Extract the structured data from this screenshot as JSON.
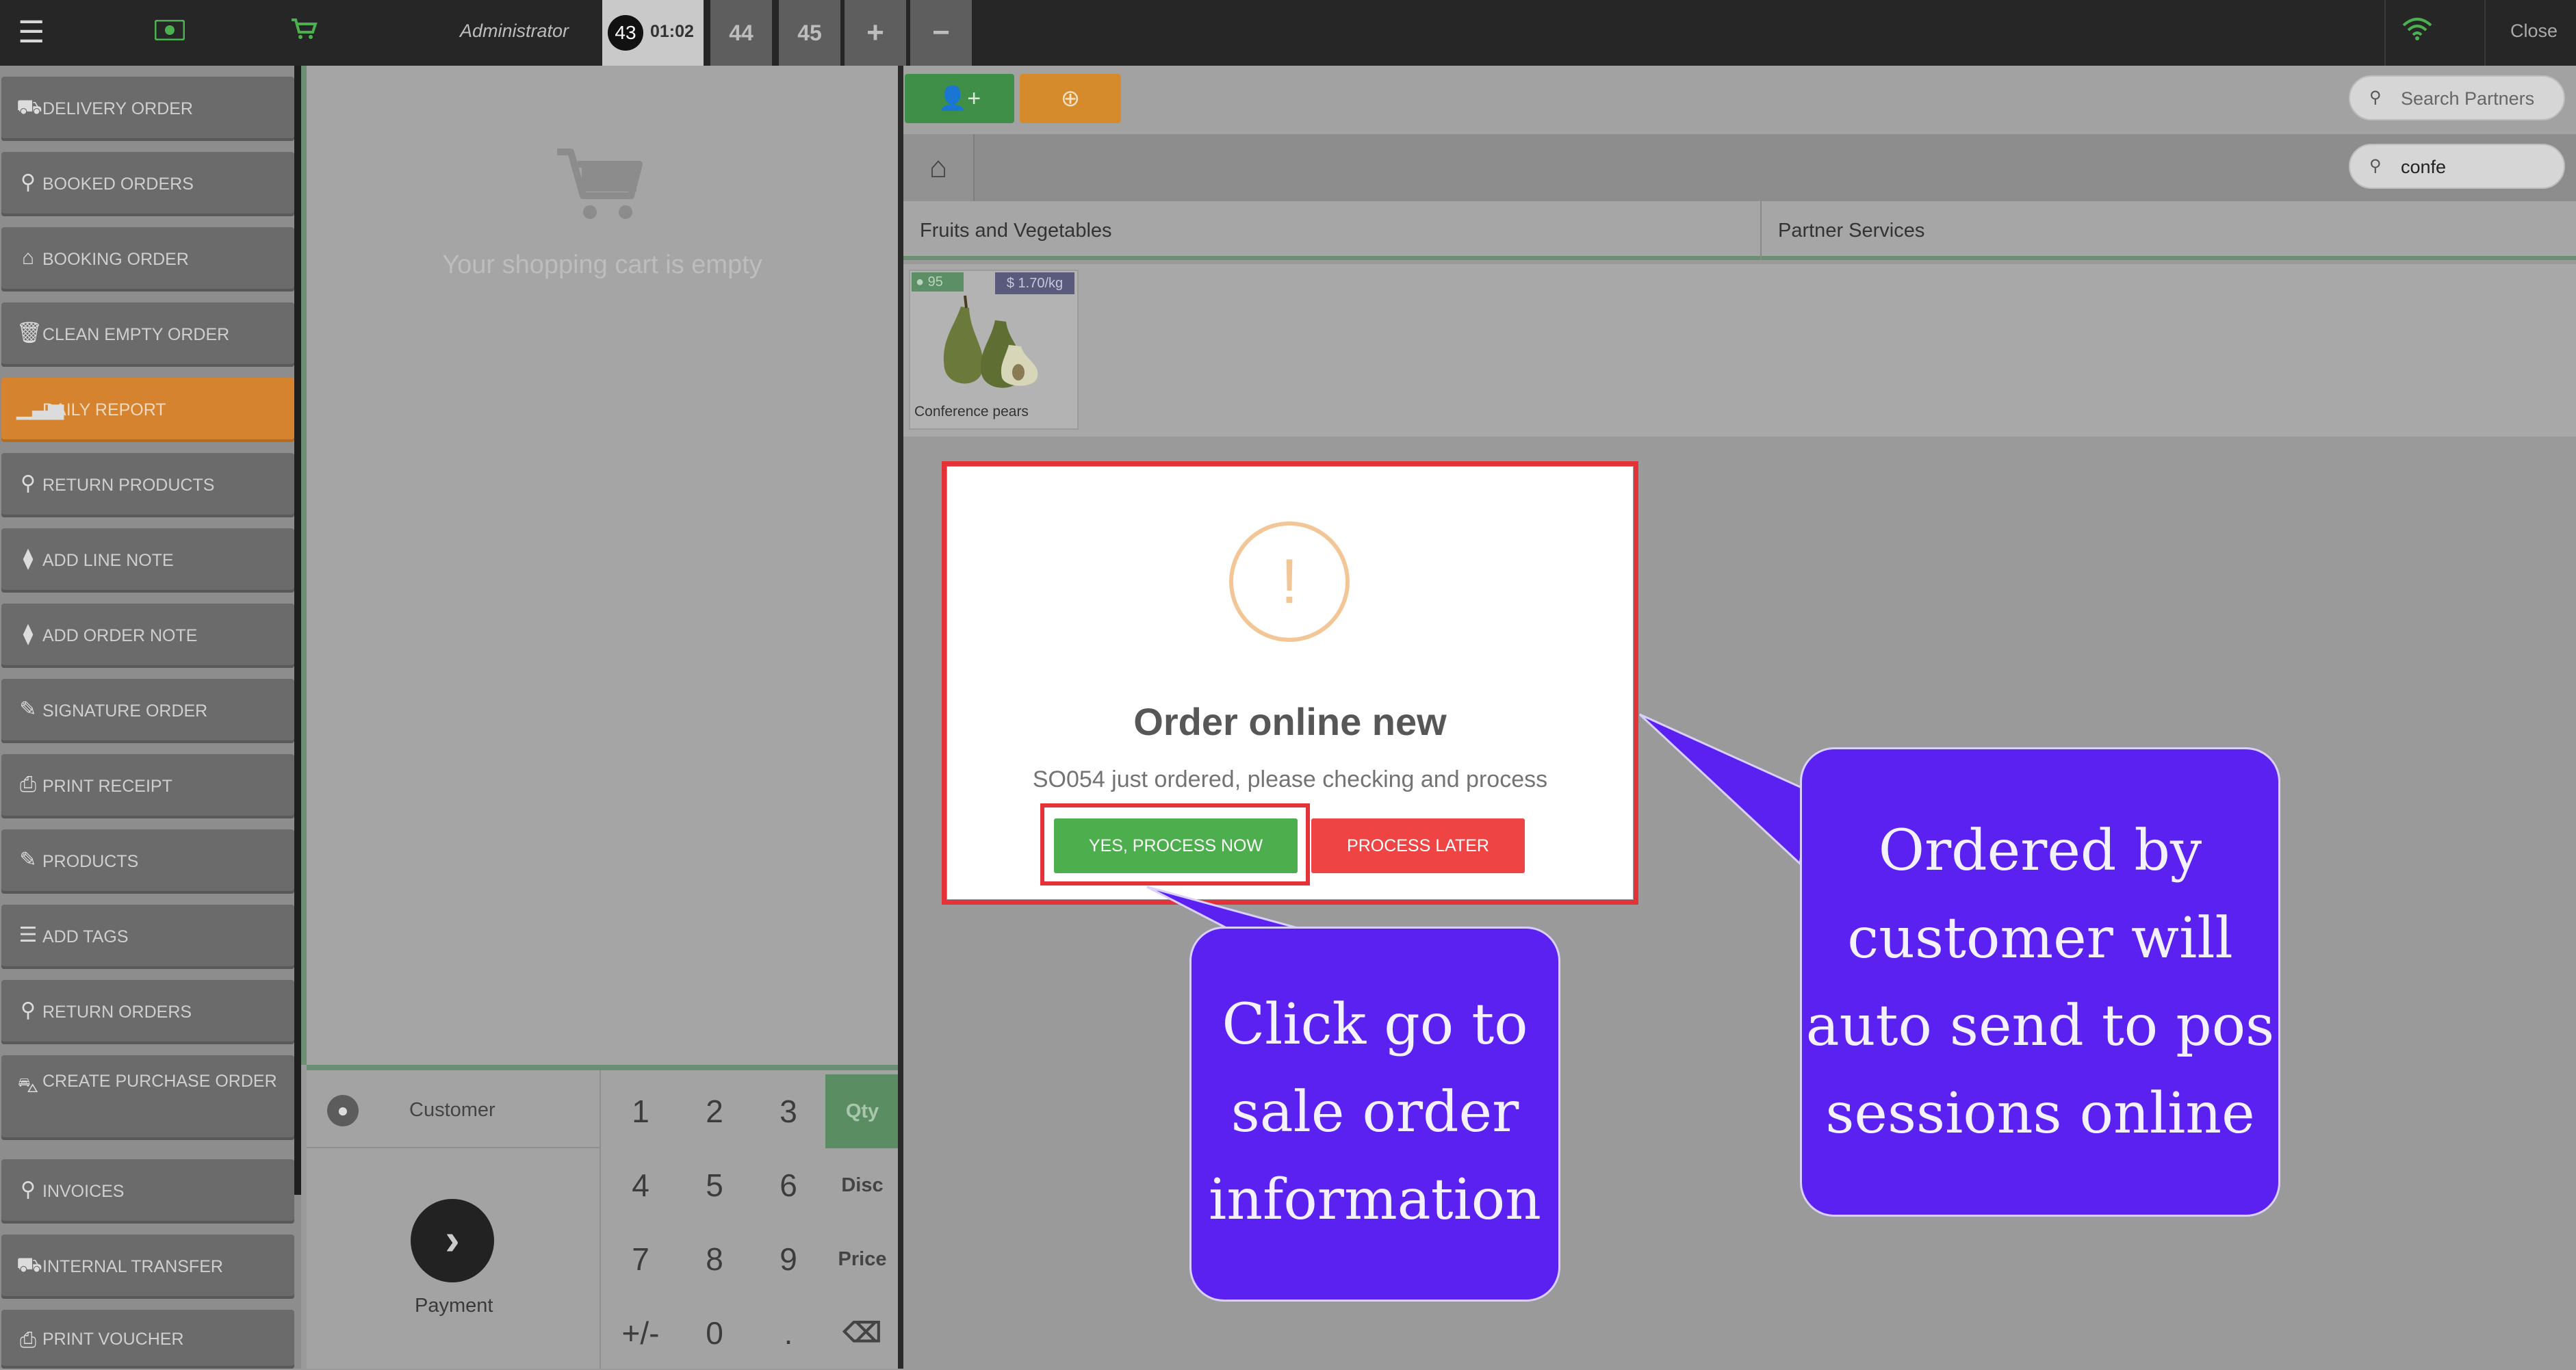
{
  "topbar": {
    "admin_label": "Administrator",
    "active_order": {
      "number": "43",
      "time": "01:02"
    },
    "orders": [
      "44",
      "45"
    ],
    "add_symbol": "+",
    "remove_symbol": "−",
    "close_label": "Close"
  },
  "sidebar": {
    "items": [
      {
        "label": "DELIVERY ORDER",
        "icon": "truck-icon"
      },
      {
        "label": "BOOKED ORDERS",
        "icon": "search-icon"
      },
      {
        "label": "BOOKING ORDER",
        "icon": "basket-icon"
      },
      {
        "label": "CLEAN EMPTY ORDER",
        "icon": "trash-icon"
      },
      {
        "label": "DAILY REPORT",
        "icon": "signal-icon",
        "highlight": true
      },
      {
        "label": "RETURN PRODUCTS",
        "icon": "search-icon"
      },
      {
        "label": "ADD LINE NOTE",
        "icon": "tag-icon"
      },
      {
        "label": "ADD ORDER NOTE",
        "icon": "tag-icon"
      },
      {
        "label": "SIGNATURE ORDER",
        "icon": "edit-icon"
      },
      {
        "label": "PRINT RECEIPT",
        "icon": "print-icon"
      },
      {
        "label": "PRODUCTS",
        "icon": "edit-icon"
      },
      {
        "label": "ADD TAGS",
        "icon": "sliders-icon"
      },
      {
        "label": "RETURN ORDERS",
        "icon": "search-icon"
      },
      {
        "label": "CREATE PURCHASE ORDER",
        "icon": "cart-icon"
      },
      {
        "label": "INVOICES",
        "icon": "search-icon"
      },
      {
        "label": "INTERNAL TRANSFER",
        "icon": "truck-icon"
      },
      {
        "label": "PRINT VOUCHER",
        "icon": "print-icon"
      }
    ]
  },
  "cart": {
    "empty_text": "Your shopping cart is empty"
  },
  "customer": {
    "label": "Customer"
  },
  "payment": {
    "label": "Payment"
  },
  "numpad": {
    "keys": [
      "1",
      "2",
      "3",
      "Qty",
      "4",
      "5",
      "6",
      "Disc",
      "7",
      "8",
      "9",
      "Price",
      "+/-",
      "0",
      ".",
      "⌫"
    ]
  },
  "search": {
    "partners_placeholder": "Search Partners",
    "products_value": "confe"
  },
  "categories": [
    "Fruits and Vegetables",
    "Partner Services"
  ],
  "product": {
    "stock": "95",
    "price": "$ 1.70/kg",
    "name": "Conference pears"
  },
  "modal": {
    "title": "Order online new",
    "message": "SO054 just ordered, please checking and process",
    "yes_label": "YES, PROCESS NOW",
    "later_label": "PROCESS LATER"
  },
  "callouts": {
    "left": [
      "Click go to",
      "sale order",
      "information"
    ],
    "right": [
      "Ordered by",
      "customer will",
      "auto send to pos",
      "sessions online"
    ]
  },
  "colors": {
    "accent_green": "#4cae4c",
    "accent_red": "#ee4444",
    "callout_purple": "#5b21f0",
    "highlight_red": "#e53238"
  }
}
